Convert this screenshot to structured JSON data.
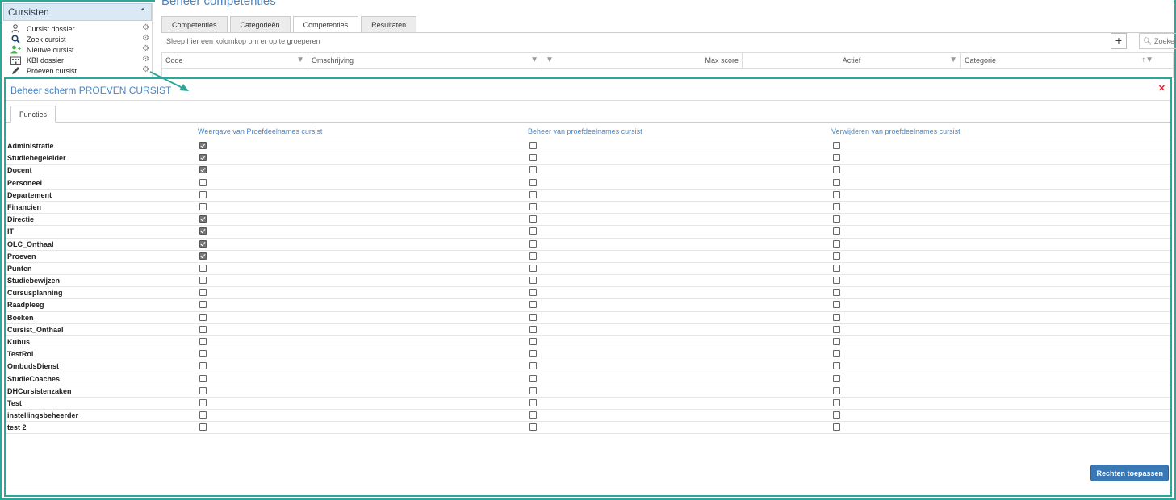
{
  "sidebar": {
    "title": "Cursisten",
    "items": [
      {
        "label": "Cursist dossier",
        "icon": "user-icon"
      },
      {
        "label": "Zoek cursist",
        "icon": "search-icon"
      },
      {
        "label": "Nieuwe cursist",
        "icon": "add-user-icon"
      },
      {
        "label": "KBI dossier",
        "icon": "building-icon"
      },
      {
        "label": "Proeven cursist",
        "icon": "pencil-icon"
      }
    ]
  },
  "main": {
    "title": "Beheer competenties",
    "tabs": [
      {
        "label": "Competenties",
        "active": false
      },
      {
        "label": "Categorieën",
        "active": false
      },
      {
        "label": "Competenties",
        "active": true
      },
      {
        "label": "Resultaten",
        "active": false
      }
    ],
    "group_hint": "Sleep hier een kolomkop om er op te groeperen",
    "search_placeholder": "Zoeken",
    "columns": [
      "Code",
      "Omschrijving",
      "Max score",
      "Actief",
      "Categorie"
    ]
  },
  "modal": {
    "title": "Beheer scherm PROEVEN CURSIST",
    "tab_label": "Functies",
    "column_headers": [
      "Weergave van Proefdeelnames cursist",
      "Beheer van proefdeelnames cursist",
      "Verwijderen van proefdeelnames cursist"
    ],
    "roles": [
      {
        "name": "Administratie",
        "view": true,
        "manage": false,
        "delete": false
      },
      {
        "name": "Studiebegeleider",
        "view": true,
        "manage": false,
        "delete": false
      },
      {
        "name": "Docent",
        "view": true,
        "manage": false,
        "delete": false
      },
      {
        "name": "Personeel",
        "view": false,
        "manage": false,
        "delete": false
      },
      {
        "name": "Departement",
        "view": false,
        "manage": false,
        "delete": false
      },
      {
        "name": "Financien",
        "view": false,
        "manage": false,
        "delete": false
      },
      {
        "name": "Directie",
        "view": true,
        "manage": false,
        "delete": false
      },
      {
        "name": "IT",
        "view": true,
        "manage": false,
        "delete": false
      },
      {
        "name": "OLC_Onthaal",
        "view": true,
        "manage": false,
        "delete": false
      },
      {
        "name": "Proeven",
        "view": true,
        "manage": false,
        "delete": false
      },
      {
        "name": "Punten",
        "view": false,
        "manage": false,
        "delete": false
      },
      {
        "name": "Studiebewijzen",
        "view": false,
        "manage": false,
        "delete": false
      },
      {
        "name": "Cursusplanning",
        "view": false,
        "manage": false,
        "delete": false
      },
      {
        "name": "Raadpleeg",
        "view": false,
        "manage": false,
        "delete": false
      },
      {
        "name": "Boeken",
        "view": false,
        "manage": false,
        "delete": false
      },
      {
        "name": "Cursist_Onthaal",
        "view": false,
        "manage": false,
        "delete": false
      },
      {
        "name": "Kubus",
        "view": false,
        "manage": false,
        "delete": false
      },
      {
        "name": "TestRol",
        "view": false,
        "manage": false,
        "delete": false
      },
      {
        "name": "OmbudsDienst",
        "view": false,
        "manage": false,
        "delete": false
      },
      {
        "name": "StudieCoaches",
        "view": false,
        "manage": false,
        "delete": false
      },
      {
        "name": "DHCursistenzaken",
        "view": false,
        "manage": false,
        "delete": false
      },
      {
        "name": "Test",
        "view": false,
        "manage": false,
        "delete": false
      },
      {
        "name": "instellingsbeheerder",
        "view": false,
        "manage": false,
        "delete": false
      },
      {
        "name": "test 2",
        "view": false,
        "manage": false,
        "delete": false
      }
    ],
    "apply_label": "Rechten toepassen",
    "close_icon": "close-icon"
  },
  "colors": {
    "accent": "#4a86c5",
    "highlight_border": "#2aa89a",
    "button": "#3a78b5",
    "close": "#d9232d"
  }
}
